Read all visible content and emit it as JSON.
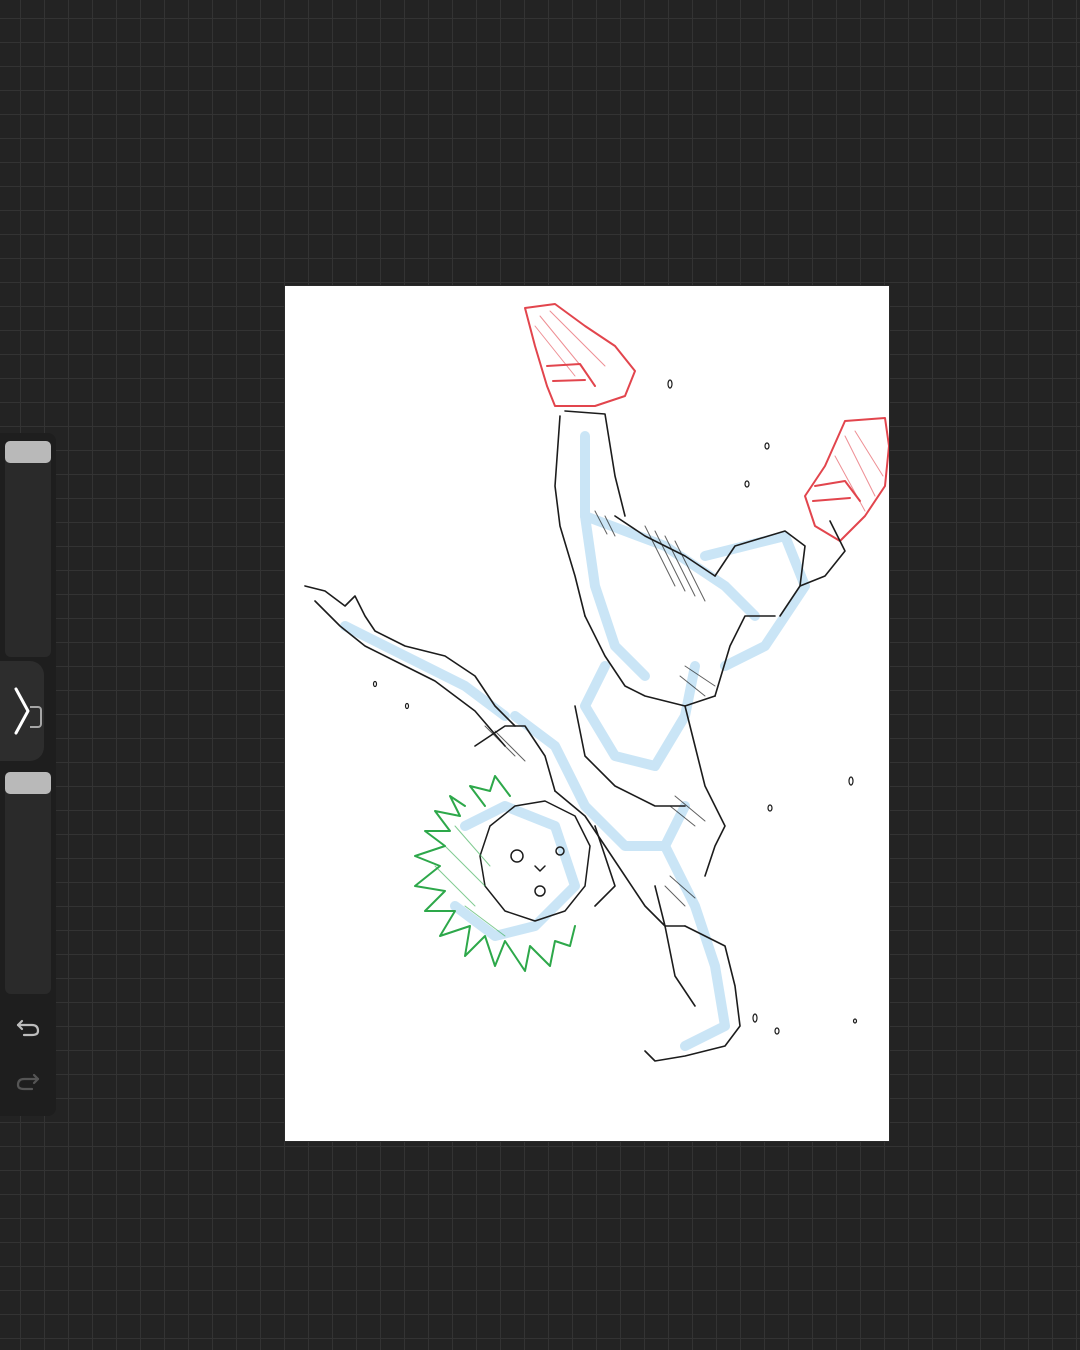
{
  "app": {
    "background_color": "#232323",
    "canvas_color": "#ffffff"
  },
  "sidebar": {
    "brush_size_slider": {
      "value": 0.0
    },
    "modify_button": {
      "icon": "chevron-right-icon"
    },
    "opacity_slider": {
      "value": 0.0
    },
    "undo_button": {
      "icon": "undo-icon"
    },
    "redo_button": {
      "icon": "redo-icon"
    }
  },
  "artwork": {
    "line_colors": {
      "sketch": "#1c1c1c",
      "blue": "#8fc4e8",
      "red": "#e2454d",
      "green": "#2da84a"
    }
  }
}
